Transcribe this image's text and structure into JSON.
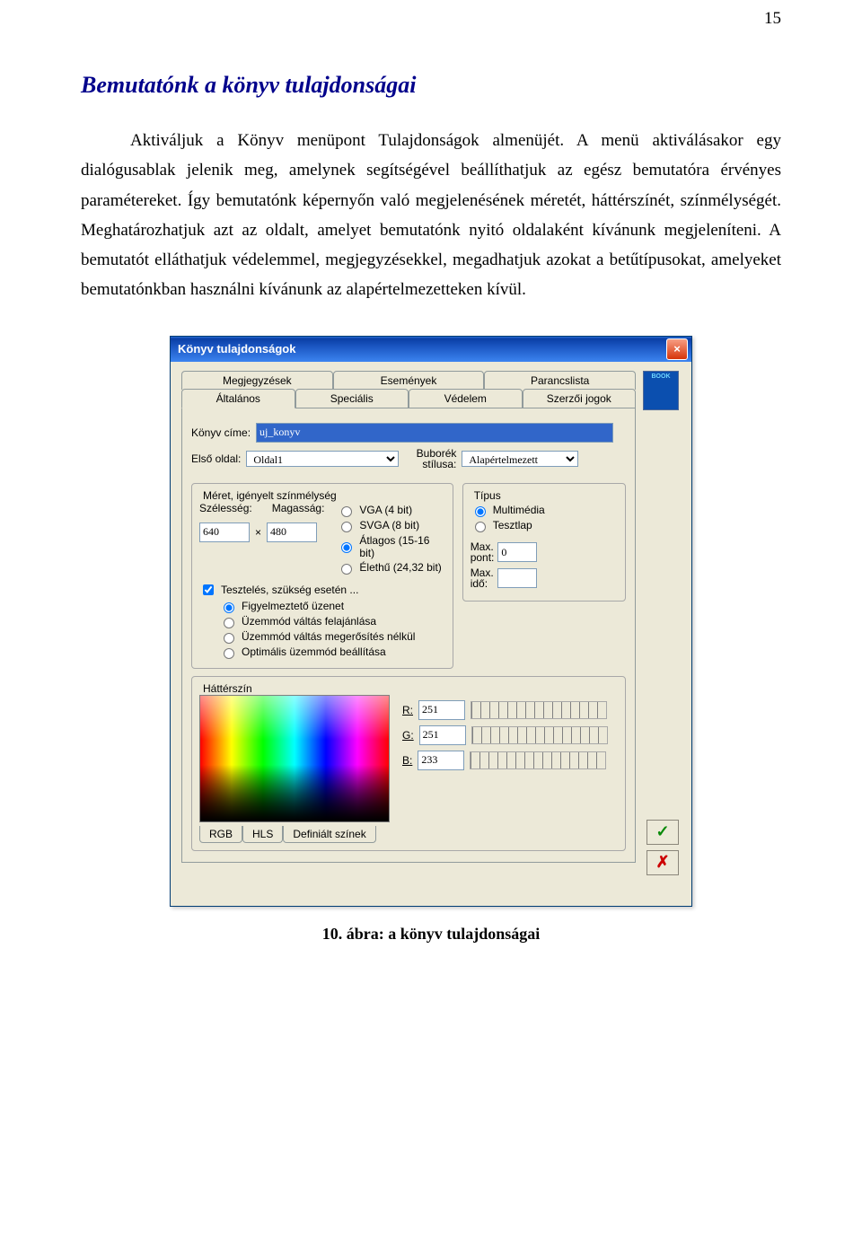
{
  "page_number": "15",
  "heading": "Bemutatónk a könyv tulajdonságai",
  "body_text": "Aktiváljuk a Könyv menüpont Tulajdonságok almenüjét. A menü aktiválásakor egy dialógusablak jelenik meg, amelynek segítségével beállíthatjuk az egész bemutatóra érvényes paramétereket. Így bemutatónk képernyőn való megjelenésének méretét, háttérszínét, színmélységét. Meghatározhatjuk azt az oldalt, amelyet bemutatónk nyitó oldalaként kívánunk megjeleníteni. A bemutatót elláthatjuk védelemmel, megjegyzésekkel, megadhatjuk azokat a betűtípusokat, amelyeket bemutatónkban használni kívánunk az alapértelmezetteken kívül.",
  "caption": "10. ábra: a könyv tulajdonságai",
  "dialog": {
    "title": "Könyv tulajdonságok",
    "tabs_back": [
      "Megjegyzések",
      "Események",
      "Parancslista"
    ],
    "tabs_front": [
      "Általános",
      "Speciális",
      "Védelem",
      "Szerzői jogok"
    ],
    "active_tab": "Általános",
    "book_title_label": "Könyv címe:",
    "book_title_value": "uj_konyv",
    "first_page_label": "Első oldal:",
    "first_page_value": "Oldal1",
    "bubble_label_l1": "Buborék",
    "bubble_label_l2": "stílusa:",
    "bubble_value": "Alapértelmezett",
    "size_group": {
      "legend": "Méret, igényelt színmélység",
      "width_label": "Szélesség:",
      "width_value": "640",
      "height_label": "Magasság:",
      "height_value": "480",
      "depth_options": [
        "VGA (4 bit)",
        "SVGA (8 bit)",
        "Átlagos (15-16 bit)",
        "Élethű (24,32 bit)"
      ],
      "depth_selected": "Átlagos (15-16 bit)",
      "test_checkbox": "Tesztelés, szükség esetén ...",
      "test_options": [
        "Figyelmeztető üzenet",
        "Üzemmód váltás felajánlása",
        "Üzemmód váltás megerősítés nélkül",
        "Optimális üzemmód beállítása"
      ],
      "test_selected": "Figyelmeztető üzenet"
    },
    "type_group": {
      "legend": "Típus",
      "options": [
        "Multimédia",
        "Tesztlap"
      ],
      "selected": "Multimédia",
      "max_point_label_l1": "Max.",
      "max_point_label_l2": "pont:",
      "max_point_value": "0",
      "max_time_label_l1": "Max.",
      "max_time_label_l2": "idő:",
      "max_time_value": ""
    },
    "bg_group": {
      "legend": "Háttérszín",
      "r_label": "R:",
      "r_value": "251",
      "g_label": "G:",
      "g_value": "251",
      "b_label": "B:",
      "b_value": "233",
      "color_tabs": [
        "RGB",
        "HLS",
        "Definiált színek"
      ]
    },
    "ok_tooltip": "OK",
    "cancel_tooltip": "Mégse"
  }
}
